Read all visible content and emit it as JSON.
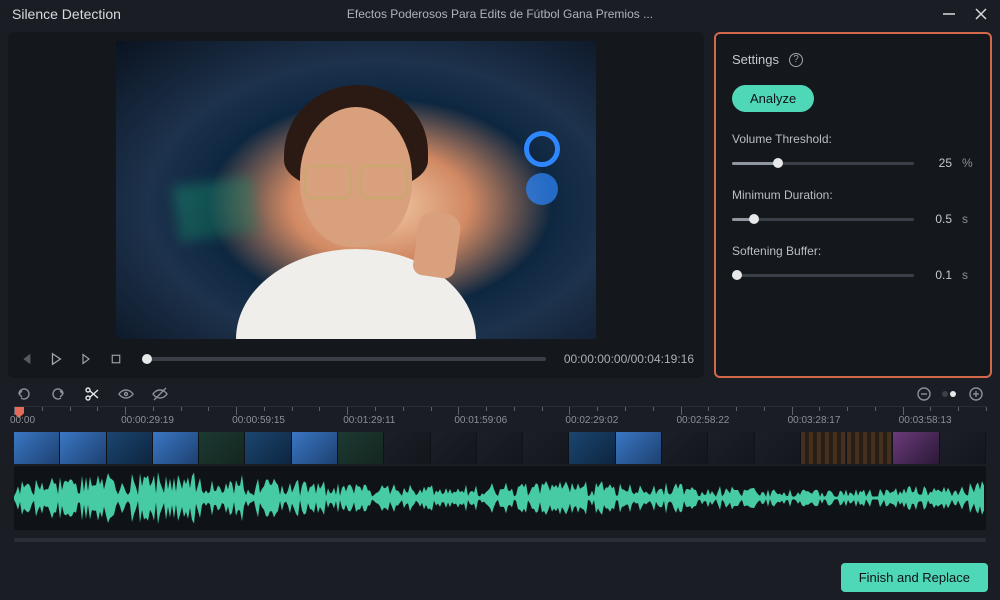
{
  "titlebar": {
    "app_title": "Silence Detection",
    "project_name": "Efectos Poderosos Para Edits de Fútbol   Gana Premios ..."
  },
  "player": {
    "timecode": "00:00:00:00/00:04:19:16"
  },
  "settings": {
    "header": "Settings",
    "help_glyph": "?",
    "analyze_label": "Analyze",
    "volume_threshold": {
      "label": "Volume Threshold:",
      "value": "25",
      "unit": "%",
      "percent": 25
    },
    "minimum_duration": {
      "label": "Minimum Duration:",
      "value": "0.5",
      "unit": "s",
      "percent": 12
    },
    "softening_buffer": {
      "label": "Softening Buffer:",
      "value": "0.1",
      "unit": "s",
      "percent": 3
    }
  },
  "ruler": {
    "marks": [
      "00:00",
      "00:00:29:19",
      "00:00:59:15",
      "00:01:29:11",
      "00:01:59:06",
      "00:02:29:02",
      "00:02:58:22",
      "00:03:28:17",
      "00:03:58:13"
    ]
  },
  "footer": {
    "finish_label": "Finish and Replace"
  }
}
